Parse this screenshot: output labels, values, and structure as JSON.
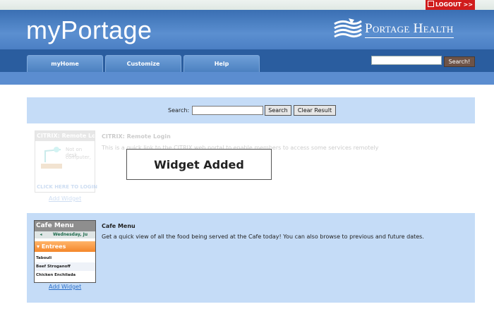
{
  "topbar": {
    "logout_label": "LOGOUT >>"
  },
  "header": {
    "brand": "myPortage",
    "partner_logo_text": "Portage Health"
  },
  "nav": {
    "tabs": [
      {
        "label": "myHome"
      },
      {
        "label": "Customize"
      },
      {
        "label": "Help"
      }
    ],
    "search_button": "Search!",
    "search_value": ""
  },
  "widget_search": {
    "label": "Search:",
    "value": "",
    "search_button": "Search",
    "clear_button": "Clear Result"
  },
  "widgets": [
    {
      "title": "CITRIX: Remote Login",
      "description": "This is a quick link to the CITRIX web portal to enable members to access some services remotely",
      "thumb_title": "CITRIX: Remote Login",
      "thumb_text_1": "Not on desk",
      "thumb_text_2": "computer,",
      "thumb_footer": "CLICK HERE TO LOGIN",
      "add_label": "Add Widget"
    },
    {
      "title": "Cafe Menu",
      "description": "Get a quick view of all the food being served at the Cafe today! You can also browse to previous and future dates.",
      "thumb_title": "Cafe Menu",
      "thumb_date": "Wednesday, Ju",
      "thumb_section": "Entrees",
      "thumb_items": [
        "Tabouli",
        "Beef Stroganoff",
        "Chicken Enchilada"
      ],
      "add_label": "Add Widget"
    }
  ],
  "toast": {
    "message": "Widget Added"
  },
  "colors": {
    "header_blue": "#4b7fc4",
    "nav_blue": "#2a5d9f",
    "panel_blue": "#c5dcf7",
    "logout_red": "#d01c1c",
    "link_blue": "#2a6ec8",
    "entrees_orange": "#f4862a"
  }
}
